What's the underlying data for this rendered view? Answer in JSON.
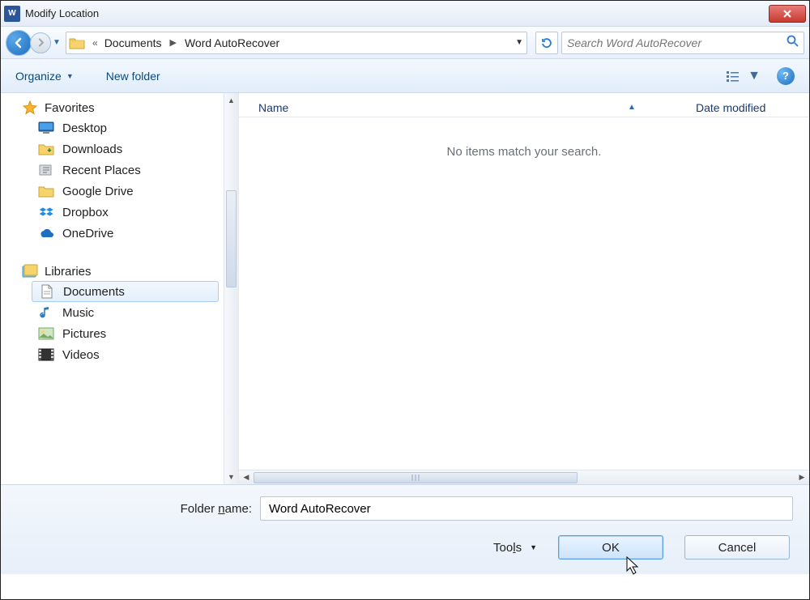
{
  "title": "Modify Location",
  "breadcrumb": {
    "prefix": "«",
    "seg1": "Documents",
    "seg2": "Word AutoRecover"
  },
  "search": {
    "placeholder": "Search Word AutoRecover"
  },
  "toolbar": {
    "organize": "Organize",
    "newfolder": "New folder"
  },
  "sidebar": {
    "favorites": {
      "label": "Favorites",
      "items": [
        {
          "label": "Desktop"
        },
        {
          "label": "Downloads"
        },
        {
          "label": "Recent Places"
        },
        {
          "label": "Google Drive"
        },
        {
          "label": "Dropbox"
        },
        {
          "label": "OneDrive"
        }
      ]
    },
    "libraries": {
      "label": "Libraries",
      "items": [
        {
          "label": "Documents"
        },
        {
          "label": "Music"
        },
        {
          "label": "Pictures"
        },
        {
          "label": "Videos"
        }
      ]
    }
  },
  "columns": {
    "name": "Name",
    "date": "Date modified"
  },
  "empty": "No items match your search.",
  "footer": {
    "folder_label_pre": "Folder ",
    "folder_label_ul": "n",
    "folder_label_post": "ame:",
    "folder_value": "Word AutoRecover",
    "tools_pre": "Too",
    "tools_ul": "l",
    "tools_post": "s",
    "ok": "OK",
    "cancel": "Cancel"
  }
}
